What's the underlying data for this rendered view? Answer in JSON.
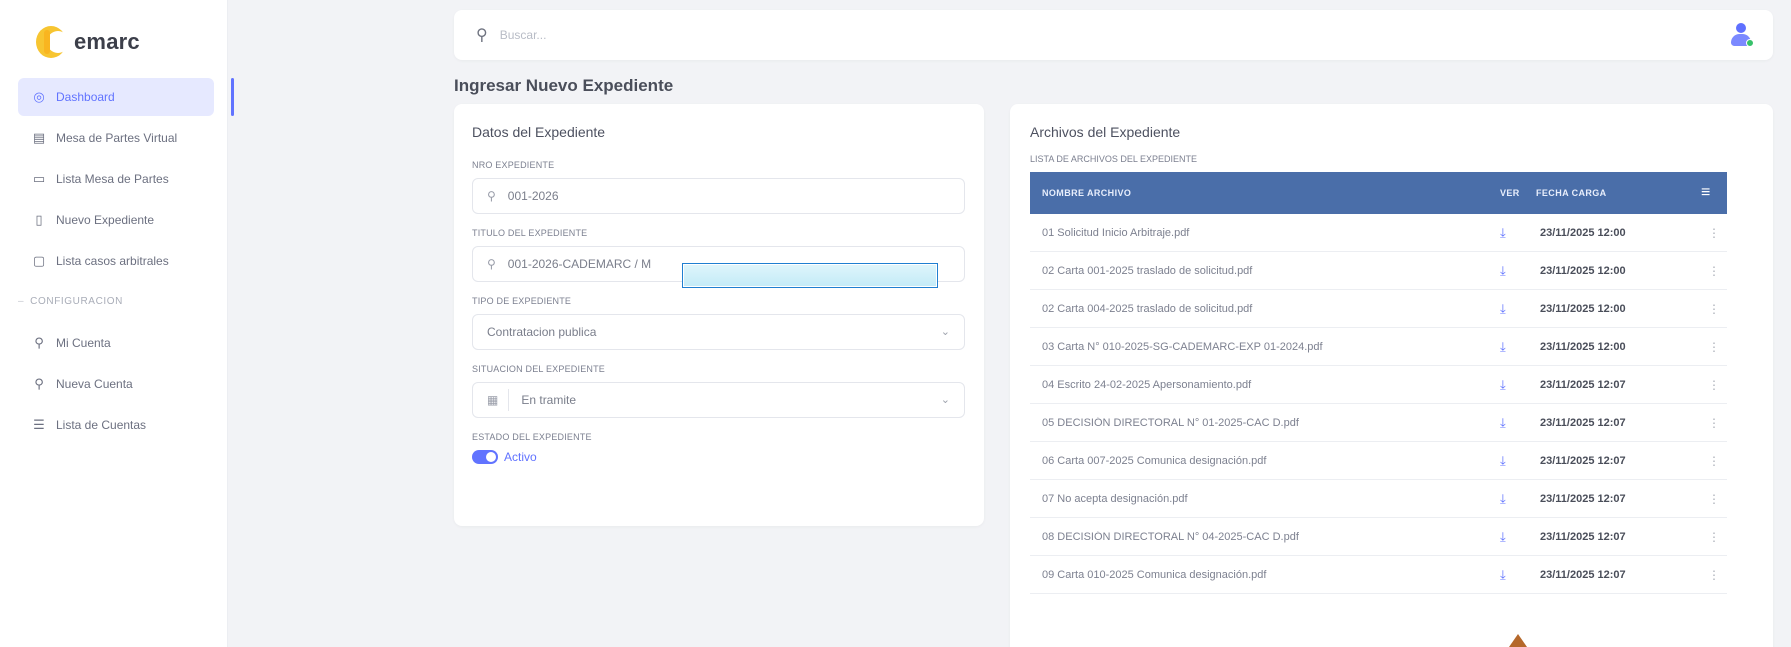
{
  "app": {
    "logo_text": "emarc"
  },
  "sidebar": {
    "items": [
      {
        "icon": "dashboard-icon",
        "glyph": "◎",
        "label": "Dashboard",
        "active": true
      },
      {
        "icon": "document-icon",
        "glyph": "▤",
        "label": "Mesa de Partes Virtual"
      },
      {
        "icon": "clipboard-icon",
        "glyph": "▭",
        "label": "Lista Mesa de Partes"
      },
      {
        "icon": "file-icon",
        "glyph": "▯",
        "label": "Nuevo Expediente"
      },
      {
        "icon": "folder-icon",
        "glyph": "▢",
        "label": "Lista casos arbitrales"
      }
    ],
    "section_label": "CONFIGURACION",
    "config_items": [
      {
        "icon": "user-icon",
        "glyph": "⚲",
        "label": "Mi Cuenta"
      },
      {
        "icon": "add-user-icon",
        "glyph": "⚲",
        "label": "Nueva Cuenta"
      },
      {
        "icon": "list-icon",
        "glyph": "☰",
        "label": "Lista de Cuentas"
      }
    ]
  },
  "search": {
    "placeholder": "Buscar..."
  },
  "page_title": "Ingresar Nuevo Expediente",
  "form": {
    "title": "Datos del Expediente",
    "nro_label": "NRO EXPEDIENTE",
    "nro_value": "001-2026",
    "titulo_label": "TITULO DEL EXPEDIENTE",
    "titulo_value": "001-2026-CADEMARC / M",
    "tipo_label": "TIPO DE EXPEDIENTE",
    "tipo_value": "Contratacion publica",
    "situacion_label": "SITUACION DEL EXPEDIENTE",
    "situacion_value": "En tramite",
    "estado_label": "ESTADO DEL EXPEDIENTE",
    "estado_value": "Activo"
  },
  "files": {
    "title": "Archivos del Expediente",
    "list_label": "LISTA DE ARCHIVOS DEL EXPEDIENTE",
    "columns": {
      "name": "NOMBRE ARCHIVO",
      "ver": "VER",
      "fecha": "FECHA CARGA",
      "menu": "≡"
    },
    "rows": [
      {
        "name": "01 Solicitud Inicio Arbitraje.pdf",
        "fecha": "23/11/2025 12:00"
      },
      {
        "name": "02 Carta 001-2025 traslado de solicitud.pdf",
        "fecha": "23/11/2025 12:00"
      },
      {
        "name": "02 Carta 004-2025 traslado de solicitud.pdf",
        "fecha": "23/11/2025 12:00"
      },
      {
        "name": "03 Carta N° 010-2025-SG-CADEMARC-EXP 01-2024.pdf",
        "fecha": "23/11/2025 12:00"
      },
      {
        "name": "04 Escrito 24-02-2025 Apersonamiento.pdf",
        "fecha": "23/11/2025 12:07"
      },
      {
        "name": "05 DECISIÓN DIRECTORAL N° 01-2025-CAC D.pdf",
        "fecha": "23/11/2025 12:07"
      },
      {
        "name": "06 Carta 007-2025 Comunica designación.pdf",
        "fecha": "23/11/2025 12:07"
      },
      {
        "name": "07 No acepta designación.pdf",
        "fecha": "23/11/2025 12:07"
      },
      {
        "name": "08 DECISIÓN DIRECTORAL N° 04-2025-CAC D.pdf",
        "fecha": "23/11/2025 12:07"
      },
      {
        "name": "09 Carta 010-2025 Comunica designación.pdf",
        "fecha": "23/11/2025 12:07"
      }
    ],
    "download_glyph": "⤓",
    "menu_glyph": "⋮"
  },
  "colors": {
    "accent": "#6173ff",
    "table_header": "#4a6ea9",
    "logo": "#f7c531"
  }
}
